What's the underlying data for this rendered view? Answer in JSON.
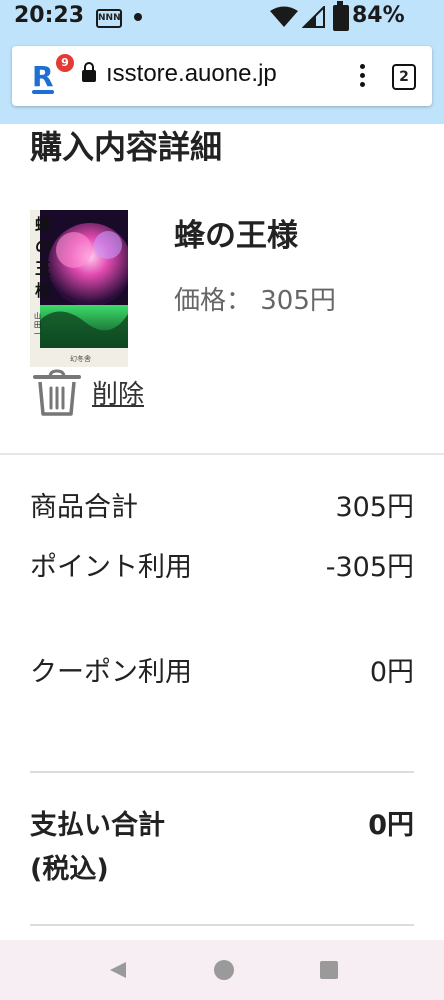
{
  "status_bar": {
    "time": "20:23",
    "nfc_label": "NNN",
    "battery": "84%"
  },
  "browser": {
    "badge_count": "9",
    "url": "ısstore.auone.jp",
    "tab_count": "2"
  },
  "page": {
    "title": "購入内容詳細",
    "item": {
      "title": "蜂の王様",
      "price": "価格： 305円",
      "delete_label": "削除",
      "cover_title": "蜂の王様",
      "cover_author": "山田 一",
      "cover_publisher": "幻冬舎"
    },
    "summary": [
      {
        "label": "商品合計",
        "value": "305円"
      },
      {
        "label": "ポイント利用",
        "value": "-305円"
      },
      {
        "label": "クーポン利用",
        "value": "0円"
      }
    ],
    "total": {
      "label": "支払い合計(税込)",
      "value": "0円"
    }
  },
  "colors": {
    "browser_chrome": "#bfe3fb",
    "brand_blue": "#1d6fd1",
    "badge_red": "#e53935",
    "nav_bar": "#f7eef4"
  }
}
